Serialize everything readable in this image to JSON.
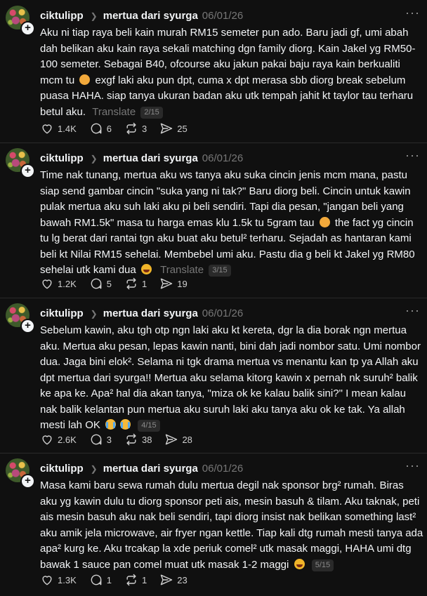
{
  "posts": [
    {
      "username": "ciktulipp",
      "community": "mertua dari syurga",
      "date": "06/01/26",
      "text_parts": [
        "Aku ni tiap raya beli kain murah RM15 semeter pun ado. Baru jadi gf, umi abah dah belikan aku kain raya sekali matching dgn family diorg. Kain Jakel yg RM50-100 semeter. Sebagai B40, ofcourse aku jakun pakai baju raya kain berkualiti mcm tu",
        "exgf laki aku pun dpt, cuma x dpt merasa sbb diorg break sebelum puasa HAHA. siap tanya ukuran badan aku utk tempah jahit kt taylor tau terharu betul aku."
      ],
      "emojis": [
        "pleading-face-emoji"
      ],
      "translate": "Translate",
      "page": "2/15",
      "likes": "1.4K",
      "comments": "6",
      "reposts": "3",
      "shares": "25"
    },
    {
      "username": "ciktulipp",
      "community": "mertua dari syurga",
      "date": "06/01/26",
      "text_parts": [
        "Time nak tunang, mertua aku ws tanya aku suka cincin jenis mcm mana, pastu siap send gambar cincin \"suka yang ni tak?\" Baru diorg beli. Cincin untuk kawin pulak mertua aku suh laki aku pi beli sendiri. Tapi dia pesan, \"jangan beli yang bawah RM1.5k\" masa tu harga emas klu 1.5k tu 5gram tau",
        "the fact yg cincin tu lg berat dari rantai tgn aku buat aku betul² terharu. Sejadah as hantaran kami beli kt Nilai RM15 sehelai. Membebel umi aku. Pastu dia g beli kt Jakel yg RM80 sehelai utk kami dua"
      ],
      "emojis": [
        "pleading-face-emoji",
        "laughing-face-emoji"
      ],
      "translate": "Translate",
      "page": "3/15",
      "likes": "1.2K",
      "comments": "5",
      "reposts": "1",
      "shares": "19"
    },
    {
      "username": "ciktulipp",
      "community": "mertua dari syurga",
      "date": "06/01/26",
      "text_parts": [
        "Sebelum kawin, aku tgh otp ngn laki aku kt kereta, dgr la dia borak ngn mertua aku. Mertua aku pesan, lepas kawin nanti, bini dah jadi nombor satu. Umi nombor dua. Jaga bini elok². Selama ni tgk drama mertua vs menantu kan tp ya Allah aku dpt mertua dari syurga!! Mertua aku selama kitorg kawin x pernah nk suruh² balik ke apa ke. Apa² hal dia akan tanya, \"miza ok ke kalau balik sini?\" I mean kalau nak balik kelantan pun mertua aku suruh laki aku tanya aku ok ke tak. Ya allah mesti lah OK"
      ],
      "emojis": [
        "crying-face-emoji",
        "crying-face-emoji"
      ],
      "translate": "",
      "page": "4/15",
      "likes": "2.6K",
      "comments": "3",
      "reposts": "38",
      "shares": "28"
    },
    {
      "username": "ciktulipp",
      "community": "mertua dari syurga",
      "date": "06/01/26",
      "text_parts": [
        "Masa kami baru sewa rumah dulu mertua degil nak sponsor brg² rumah. Biras aku yg kawin dulu tu diorg sponsor peti ais, mesin basuh & tilam. Aku taknak, peti ais mesin basuh aku nak beli sendiri, tapi diorg insist nak belikan something last² aku amik jela microwave, air fryer ngan kettle. Tiap kali dtg rumah mesti tanya ada apa² kurg ke. Aku trcakap la xde periuk comel² utk masak maggi, HAHA umi dtg bawak 1 sauce pan comel muat utk masak 1-2 maggi"
      ],
      "emojis": [
        "laughing-face-emoji"
      ],
      "translate": "",
      "page": "5/15",
      "likes": "1.3K",
      "comments": "1",
      "reposts": "1",
      "shares": "23"
    }
  ]
}
